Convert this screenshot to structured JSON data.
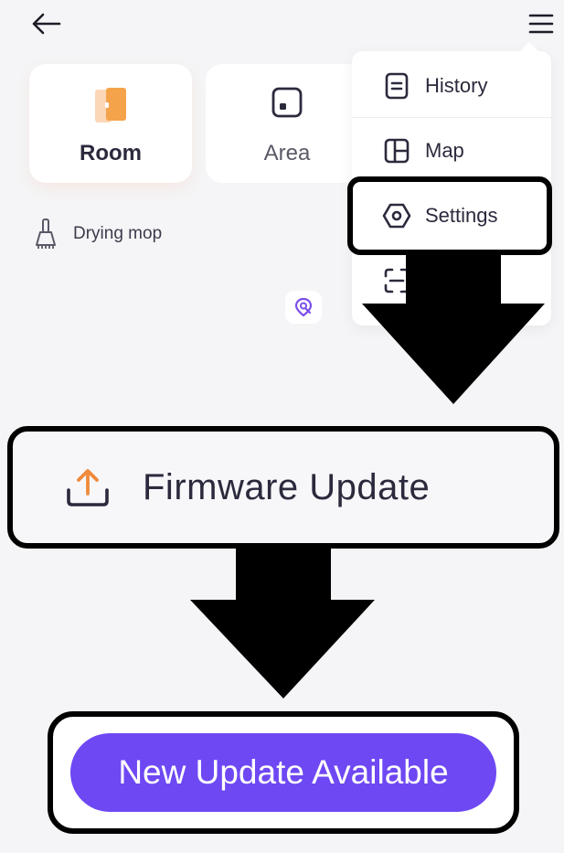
{
  "modes": {
    "room": {
      "label": "Room",
      "icon": "room-door-icon"
    },
    "area": {
      "label": "Area",
      "icon": "area-square-icon"
    }
  },
  "status": {
    "mop_label": "Drying mop",
    "icon": "mop-icon"
  },
  "menu": {
    "items": [
      {
        "label": "History",
        "icon": "history-icon"
      },
      {
        "label": "Map",
        "icon": "map-icon"
      },
      {
        "label": "Settings",
        "icon": "settings-hexagon-icon"
      },
      {
        "label": "",
        "icon": "scan-icon"
      }
    ]
  },
  "settings_page": {
    "firmware_label": "Firmware Update",
    "firmware_icon": "upload-tray-icon"
  },
  "firmware_page": {
    "update_button_label": "New Update Available"
  },
  "colors": {
    "accent_purple": "#6e48f3",
    "room_orange": "#f5a34a",
    "upload_orange": "#f08a3c",
    "highlight_border": "#000000"
  }
}
